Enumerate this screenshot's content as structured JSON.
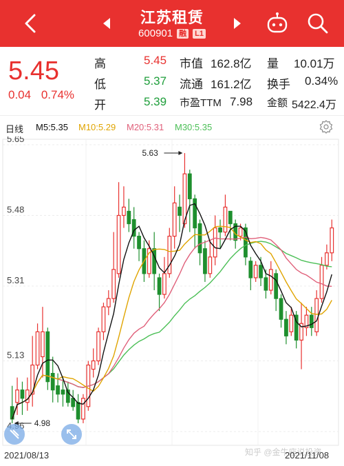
{
  "header": {
    "stock_name": "江苏租赁",
    "stock_code": "600901",
    "badge_rong": "融",
    "badge_level": "L1",
    "icons": [
      "back-arrow-icon",
      "prev-triangle-icon",
      "next-triangle-icon",
      "robot-icon",
      "search-icon"
    ]
  },
  "quote": {
    "price": "5.45",
    "change": "0.04",
    "change_pct": "0.74%",
    "rows": [
      {
        "label1": "高",
        "val1": "5.45",
        "label2": "市值",
        "val2": "162.8亿",
        "label3": "量",
        "val3": "10.01万"
      },
      {
        "label1": "低",
        "val1": "5.37",
        "label2": "流通",
        "val2": "161.2亿",
        "label3": "换手",
        "val3": "0.34%"
      },
      {
        "label1": "开",
        "val1": "5.39",
        "label2": "市盈TTM",
        "val2": "7.98",
        "label3": "金额",
        "val3": "5422.4万"
      }
    ]
  },
  "ma_bar": {
    "period": "日线",
    "ma5": "M5:5.35",
    "ma10": "M10:5.29",
    "ma20": "M20:5.31",
    "ma30": "M30:5.35",
    "colors": {
      "ma5": "#111111",
      "ma10": "#e0a400",
      "ma20": "#e0607a",
      "ma30": "#4bbf56"
    }
  },
  "chart_data": {
    "type": "candlestick",
    "y_ticks": [
      "5.65",
      "5.48",
      "5.31",
      "5.13",
      "4.96"
    ],
    "ylim": [
      4.96,
      5.65
    ],
    "high_label": "5.63",
    "low_label": "4.98",
    "x_start": "2021/08/13",
    "x_end": "2021/11/08",
    "colors": {
      "up": "#e8312f",
      "down": "#1e8f2e"
    },
    "candles": [
      {
        "o": 5.02,
        "c": 4.99,
        "h": 5.07,
        "l": 4.98
      },
      {
        "o": 5.03,
        "c": 5.06,
        "h": 5.09,
        "l": 5.0
      },
      {
        "o": 5.06,
        "c": 5.04,
        "h": 5.08,
        "l": 5.0
      },
      {
        "o": 5.03,
        "c": 5.06,
        "h": 5.09,
        "l": 5.01
      },
      {
        "o": 5.05,
        "c": 5.12,
        "h": 5.19,
        "l": 5.02
      },
      {
        "o": 5.12,
        "c": 5.2,
        "h": 5.22,
        "l": 5.11
      },
      {
        "o": 5.14,
        "c": 5.2,
        "h": 5.26,
        "l": 5.09
      },
      {
        "o": 5.2,
        "c": 5.08,
        "h": 5.21,
        "l": 5.06
      },
      {
        "o": 5.1,
        "c": 5.06,
        "h": 5.14,
        "l": 5.03
      },
      {
        "o": 5.07,
        "c": 5.05,
        "h": 5.1,
        "l": 5.03
      },
      {
        "o": 5.06,
        "c": 5.05,
        "h": 5.09,
        "l": 5.02
      },
      {
        "o": 5.06,
        "c": 5.03,
        "h": 5.08,
        "l": 5.02
      },
      {
        "o": 5.04,
        "c": 5.02,
        "h": 5.06,
        "l": 5.01
      },
      {
        "o": 5.03,
        "c": 4.99,
        "h": 5.05,
        "l": 4.98
      },
      {
        "o": 4.99,
        "c": 5.04,
        "h": 5.05,
        "l": 4.98
      },
      {
        "o": 5.02,
        "c": 5.12,
        "h": 5.13,
        "l": 5.01
      },
      {
        "o": 5.11,
        "c": 5.13,
        "h": 5.16,
        "l": 5.09
      },
      {
        "o": 5.13,
        "c": 5.2,
        "h": 5.21,
        "l": 5.12
      },
      {
        "o": 5.2,
        "c": 5.26,
        "h": 5.27,
        "l": 5.18
      },
      {
        "o": 5.26,
        "c": 5.28,
        "h": 5.3,
        "l": 5.24
      },
      {
        "o": 5.28,
        "c": 5.35,
        "h": 5.44,
        "l": 5.27
      },
      {
        "o": 5.34,
        "c": 5.48,
        "h": 5.56,
        "l": 5.33
      },
      {
        "o": 5.48,
        "c": 5.5,
        "h": 5.55,
        "l": 5.45
      },
      {
        "o": 5.49,
        "c": 5.46,
        "h": 5.52,
        "l": 5.44
      },
      {
        "o": 5.47,
        "c": 5.43,
        "h": 5.5,
        "l": 5.4
      },
      {
        "o": 5.43,
        "c": 5.4,
        "h": 5.44,
        "l": 5.37
      },
      {
        "o": 5.4,
        "c": 5.34,
        "h": 5.42,
        "l": 5.32
      },
      {
        "o": 5.34,
        "c": 5.4,
        "h": 5.42,
        "l": 5.33
      },
      {
        "o": 5.4,
        "c": 5.34,
        "h": 5.44,
        "l": 5.3
      },
      {
        "o": 5.33,
        "c": 5.29,
        "h": 5.34,
        "l": 5.25
      },
      {
        "o": 5.29,
        "c": 5.34,
        "h": 5.38,
        "l": 5.28
      },
      {
        "o": 5.34,
        "c": 5.43,
        "h": 5.45,
        "l": 5.33
      },
      {
        "o": 5.43,
        "c": 5.51,
        "h": 5.55,
        "l": 5.4
      },
      {
        "o": 5.5,
        "c": 5.48,
        "h": 5.53,
        "l": 5.44
      },
      {
        "o": 5.46,
        "c": 5.58,
        "h": 5.63,
        "l": 5.45
      },
      {
        "o": 5.58,
        "c": 5.52,
        "h": 5.59,
        "l": 5.44
      },
      {
        "o": 5.52,
        "c": 5.45,
        "h": 5.53,
        "l": 5.4
      },
      {
        "o": 5.46,
        "c": 5.39,
        "h": 5.47,
        "l": 5.36
      },
      {
        "o": 5.4,
        "c": 5.34,
        "h": 5.42,
        "l": 5.32
      },
      {
        "o": 5.34,
        "c": 5.38,
        "h": 5.42,
        "l": 5.33
      },
      {
        "o": 5.38,
        "c": 5.45,
        "h": 5.48,
        "l": 5.36
      },
      {
        "o": 5.45,
        "c": 5.44,
        "h": 5.47,
        "l": 5.4
      },
      {
        "o": 5.44,
        "c": 5.5,
        "h": 5.53,
        "l": 5.43
      },
      {
        "o": 5.49,
        "c": 5.46,
        "h": 5.49,
        "l": 5.42
      },
      {
        "o": 5.46,
        "c": 5.42,
        "h": 5.47,
        "l": 5.4
      },
      {
        "o": 5.43,
        "c": 5.45,
        "h": 5.46,
        "l": 5.42
      },
      {
        "o": 5.45,
        "c": 5.38,
        "h": 5.46,
        "l": 5.36
      },
      {
        "o": 5.37,
        "c": 5.33,
        "h": 5.38,
        "l": 5.3
      },
      {
        "o": 5.33,
        "c": 5.36,
        "h": 5.37,
        "l": 5.32
      },
      {
        "o": 5.36,
        "c": 5.33,
        "h": 5.38,
        "l": 5.31
      },
      {
        "o": 5.33,
        "c": 5.3,
        "h": 5.35,
        "l": 5.28
      },
      {
        "o": 5.3,
        "c": 5.35,
        "h": 5.37,
        "l": 5.29
      },
      {
        "o": 5.34,
        "c": 5.28,
        "h": 5.35,
        "l": 5.25
      },
      {
        "o": 5.28,
        "c": 5.23,
        "h": 5.29,
        "l": 5.21
      },
      {
        "o": 5.23,
        "c": 5.19,
        "h": 5.25,
        "l": 5.17
      },
      {
        "o": 5.2,
        "c": 5.24,
        "h": 5.26,
        "l": 5.19
      },
      {
        "o": 5.24,
        "c": 5.18,
        "h": 5.25,
        "l": 5.16
      },
      {
        "o": 5.18,
        "c": 5.22,
        "h": 5.27,
        "l": 5.11
      },
      {
        "o": 5.21,
        "c": 5.24,
        "h": 5.26,
        "l": 5.19
      },
      {
        "o": 5.24,
        "c": 5.21,
        "h": 5.26,
        "l": 5.19
      },
      {
        "o": 5.2,
        "c": 5.28,
        "h": 5.3,
        "l": 5.19
      },
      {
        "o": 5.28,
        "c": 5.36,
        "h": 5.38,
        "l": 5.27
      },
      {
        "o": 5.36,
        "c": 5.39,
        "h": 5.41,
        "l": 5.35
      },
      {
        "o": 5.39,
        "c": 5.45,
        "h": 5.47,
        "l": 5.37
      }
    ]
  },
  "watermark": "知乎 @金牛座说投资"
}
